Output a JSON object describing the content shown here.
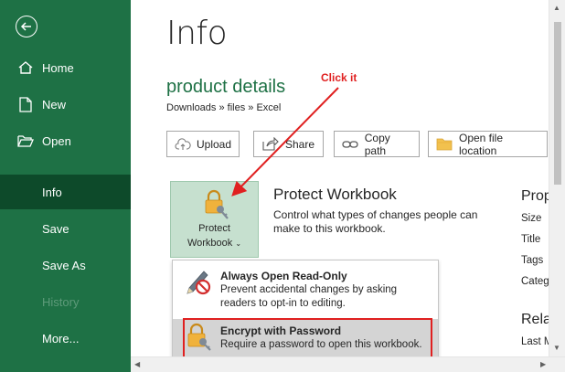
{
  "sidebar": {
    "items": [
      {
        "label": "Home"
      },
      {
        "label": "New"
      },
      {
        "label": "Open"
      },
      {
        "label": "Info"
      },
      {
        "label": "Save"
      },
      {
        "label": "Save As"
      },
      {
        "label": "History"
      },
      {
        "label": "More..."
      }
    ]
  },
  "main": {
    "title": "Info",
    "file_name": "product details",
    "breadcrumb": "Downloads » files » Excel",
    "actions": [
      {
        "label": "Upload"
      },
      {
        "label": "Share"
      },
      {
        "label": "Copy path"
      },
      {
        "label": "Open file location"
      }
    ],
    "protect": {
      "button_label_line1": "Protect",
      "button_label_line2": "Workbook",
      "title": "Protect Workbook",
      "description": "Control what types of changes people can make to this workbook."
    },
    "properties": {
      "title": "Prop",
      "rows": [
        "Size",
        "Title",
        "Tags",
        "Categ"
      ],
      "related_title": "Rela",
      "related_rows": [
        "Last M"
      ]
    }
  },
  "dropdown": {
    "items": [
      {
        "title": "Always Open Read-Only",
        "description_line1": "Prevent accidental changes by asking",
        "description_line2": "readers to opt-in to editing."
      },
      {
        "title": "Encrypt with Password",
        "description_line1": "Require a password to open this workbook."
      }
    ]
  },
  "annotation": {
    "label": "Click it",
    "color": "#e02020"
  },
  "colors": {
    "accent": "#1e7145",
    "sidebar_active": "#0d4a2a"
  }
}
